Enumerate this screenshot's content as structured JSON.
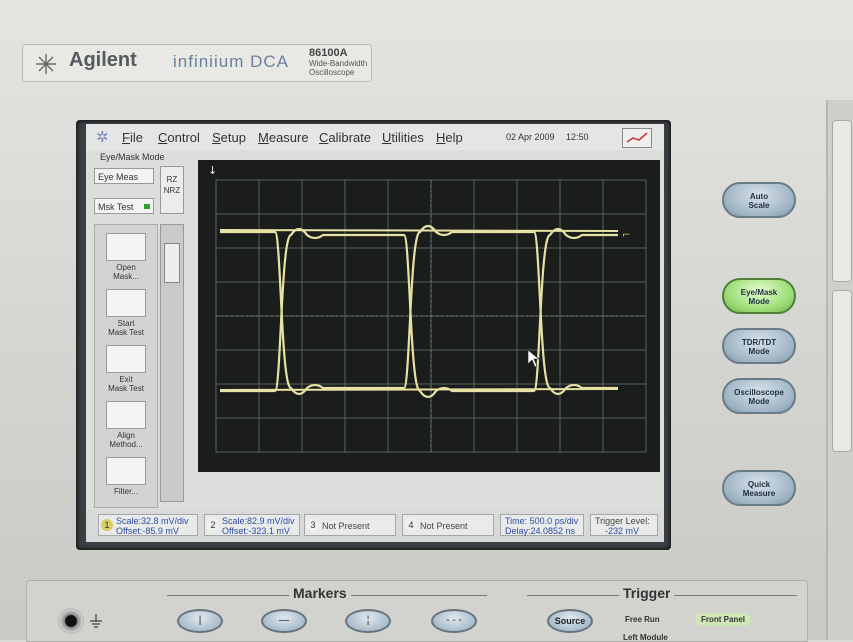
{
  "brand": {
    "name": "Agilent",
    "product": "infiniium DCA",
    "model": "86100A",
    "desc_line1": "Wide-Bandwidth",
    "desc_line2": "Oscilloscope"
  },
  "menu": {
    "items": [
      "File",
      "Control",
      "Setup",
      "Measure",
      "Calibrate",
      "Utilities",
      "Help"
    ],
    "date": "02 Apr 2009",
    "time": "12:50"
  },
  "mode_label": "Eye/Mask Mode",
  "toolbar": {
    "eye_meas": "Eye Meas",
    "mask_test": "Msk Test",
    "rz": "RZ",
    "nrz": "NRZ"
  },
  "tools": [
    {
      "line1": "Open",
      "line2": "Mask..."
    },
    {
      "line1": "Start",
      "line2": "Mask Test"
    },
    {
      "line1": "Exit",
      "line2": "Mask Test"
    },
    {
      "line1": "Align",
      "line2": "Method..."
    },
    {
      "line1": "Filter...",
      "line2": ""
    }
  ],
  "status": {
    "ch1": {
      "num": "1",
      "scale": "Scale:32.8 mV/div",
      "offset": "Offset:-85.9 mV"
    },
    "ch2": {
      "num": "2",
      "scale": "Scale:82.9 mV/div",
      "offset": "Offset:-323.1 mV"
    },
    "ch3": {
      "num": "3",
      "text": "Not Present"
    },
    "ch4": {
      "num": "4",
      "text": "Not Present"
    },
    "time": {
      "line1": "Time: 500.0 ps/div",
      "line2": "Delay:24.0852 ns"
    },
    "trigger": {
      "line1": "Trigger Level:",
      "line2": "-232 mV"
    }
  },
  "panel_buttons": {
    "auto_scale": {
      "l1": "Auto",
      "l2": "Scale"
    },
    "eye_mask": {
      "l1": "Eye/Mask",
      "l2": "Mode"
    },
    "tdr": {
      "l1": "TDR/TDT",
      "l2": "Mode"
    },
    "oscilloscope": {
      "l1": "Oscilloscope",
      "l2": "Mode"
    },
    "quick_measure": {
      "l1": "Quick",
      "l2": "Measure"
    }
  },
  "bottom": {
    "markers_title": "Markers",
    "trigger_title": "Trigger",
    "source_label": "Source",
    "free_run": "Free Run",
    "front_panel": "Front Panel",
    "left_module": "Left Module"
  },
  "colors": {
    "trace": "#e6e2a4",
    "grid": "#55615c",
    "display_bg": "#1b1d1c"
  }
}
